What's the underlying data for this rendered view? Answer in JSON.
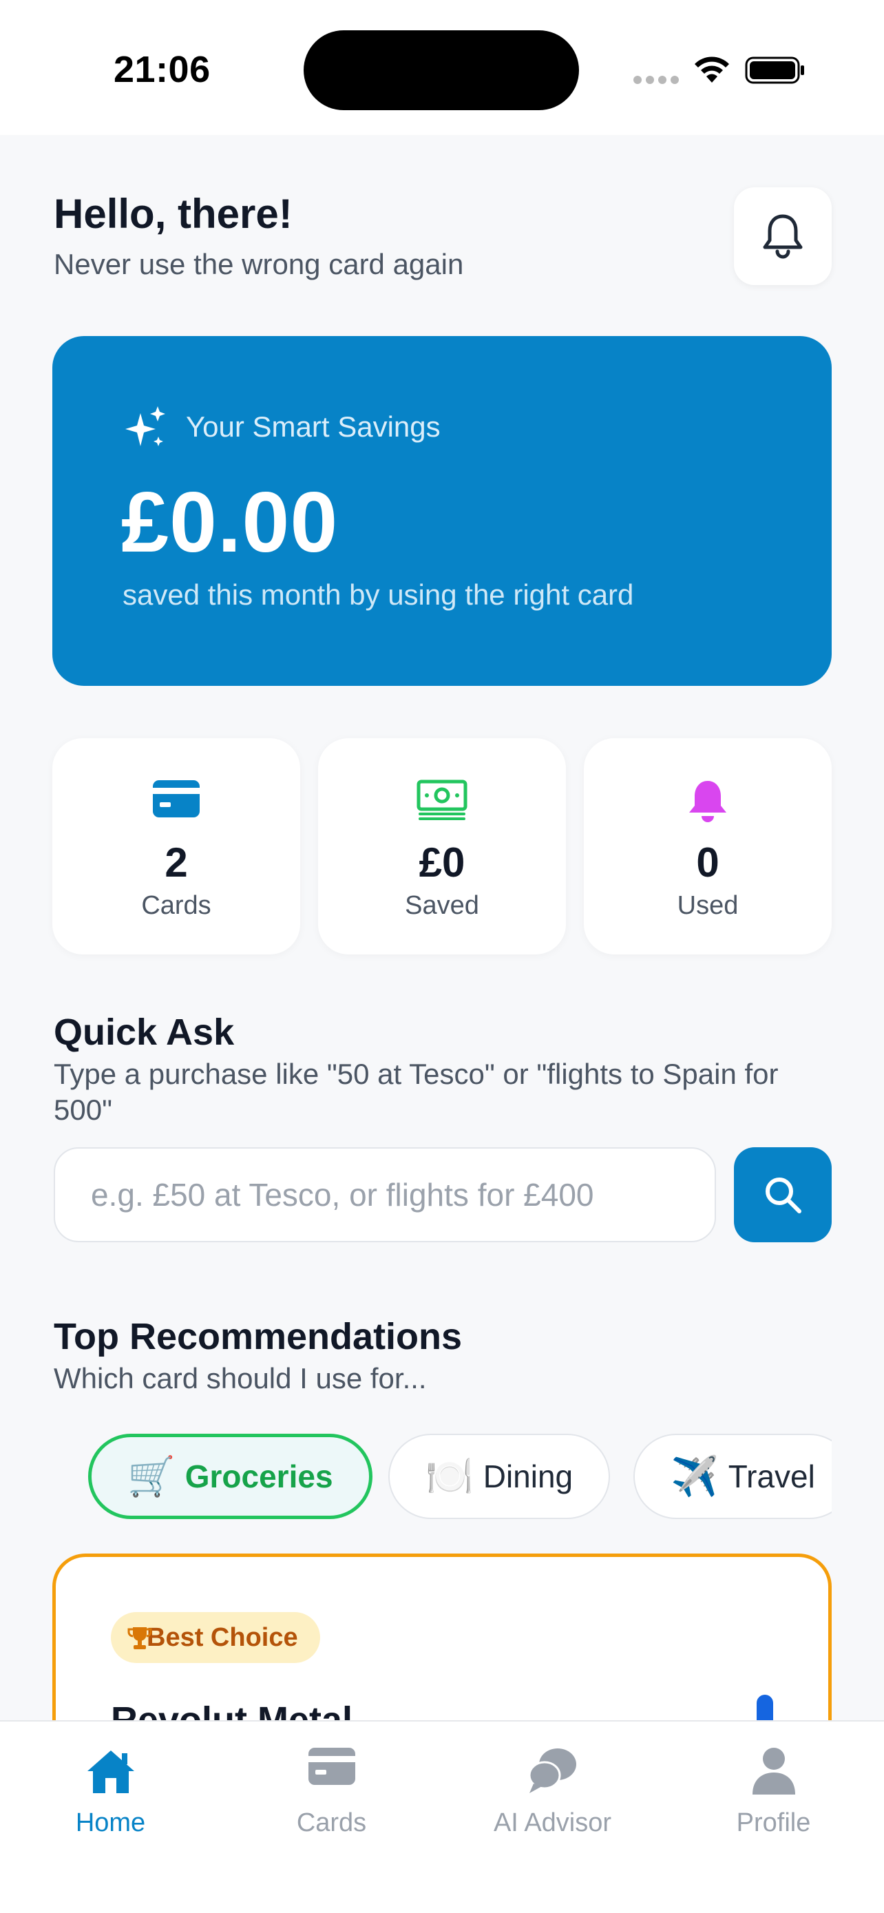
{
  "status_bar": {
    "time": "21:06"
  },
  "header": {
    "greeting": "Hello, there!",
    "subtitle": "Never use the wrong card again",
    "bell_icon": "bell-icon"
  },
  "savings": {
    "label": "Your Smart Savings",
    "amount": "£0.00",
    "note": "saved this month by using the right card",
    "icon": "sparkles-icon",
    "color": "#0783c7"
  },
  "stats": [
    {
      "value": "2",
      "label": "Cards",
      "icon": "credit-card-icon",
      "color": "#0783c7"
    },
    {
      "value": "£0",
      "label": "Saved",
      "icon": "cash-icon",
      "color": "#22c55e"
    },
    {
      "value": "0",
      "label": "Used",
      "icon": "bell-icon",
      "color": "#d946ef"
    }
  ],
  "quick_ask": {
    "title": "Quick Ask",
    "subtitle": "Type a purchase like \"50 at Tesco\" or \"flights to Spain for 500\"",
    "placeholder": "e.g. £50 at Tesco, or flights for £400",
    "value": ""
  },
  "recommendations": {
    "title": "Top Recommendations",
    "subtitle": "Which card should I use for...",
    "chips": [
      {
        "emoji": "🛒",
        "label": "Groceries",
        "active": true
      },
      {
        "emoji": "🍽️",
        "label": "Dining",
        "active": false
      },
      {
        "emoji": "✈️",
        "label": "Travel",
        "active": false
      }
    ],
    "card": {
      "badge": "Best Choice",
      "name": "Revolut Metal"
    }
  },
  "tabs": [
    {
      "label": "Home",
      "icon": "home-icon",
      "active": true
    },
    {
      "label": "Cards",
      "icon": "credit-card-icon",
      "active": false
    },
    {
      "label": "AI Advisor",
      "icon": "chat-bubbles-icon",
      "active": false
    },
    {
      "label": "Profile",
      "icon": "person-icon",
      "active": false
    }
  ],
  "colors": {
    "accent": "#0783c7",
    "active_chip": "#22c55e",
    "best_choice_border": "#f59e0b"
  }
}
